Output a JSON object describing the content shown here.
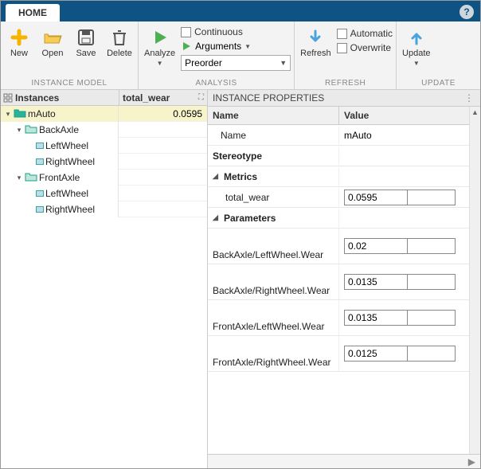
{
  "tabs": {
    "home": "HOME"
  },
  "ribbon": {
    "instance_model": {
      "label": "INSTANCE MODEL",
      "new": "New",
      "open": "Open",
      "save": "Save",
      "delete": "Delete"
    },
    "analysis": {
      "label": "ANALYSIS",
      "analyze": "Analyze",
      "continuous": "Continuous",
      "arguments": "Arguments",
      "combo_value": "Preorder"
    },
    "refresh": {
      "label": "REFRESH",
      "refresh": "Refresh",
      "automatic": "Automatic",
      "overwrite": "Overwrite"
    },
    "update": {
      "label": "UPDATE",
      "update": "Update"
    }
  },
  "left": {
    "col_instances": "Instances",
    "col_total_wear": "total_wear",
    "rows": [
      {
        "indent": 0,
        "expander": "▾",
        "icon": "folder-open",
        "label": "mAuto",
        "value": "0.0595",
        "selected": true
      },
      {
        "indent": 1,
        "expander": "▾",
        "icon": "folder",
        "label": "BackAxle",
        "value": ""
      },
      {
        "indent": 2,
        "expander": "",
        "icon": "leaf",
        "label": "LeftWheel",
        "value": ""
      },
      {
        "indent": 2,
        "expander": "",
        "icon": "leaf",
        "label": "RightWheel",
        "value": ""
      },
      {
        "indent": 1,
        "expander": "▾",
        "icon": "folder",
        "label": "FrontAxle",
        "value": ""
      },
      {
        "indent": 2,
        "expander": "",
        "icon": "leaf",
        "label": "LeftWheel",
        "value": ""
      },
      {
        "indent": 2,
        "expander": "",
        "icon": "leaf",
        "label": "RightWheel",
        "value": ""
      }
    ]
  },
  "right": {
    "title": "INSTANCE PROPERTIES",
    "col_name": "Name",
    "col_value": "Value",
    "rows": [
      {
        "kind": "plain",
        "name": "Name",
        "value_text": "mAuto"
      },
      {
        "kind": "section",
        "name": "Stereotype"
      },
      {
        "kind": "group",
        "name": "Metrics"
      },
      {
        "kind": "metric",
        "name": "total_wear",
        "value": "0.0595"
      },
      {
        "kind": "group",
        "name": "Parameters"
      },
      {
        "kind": "param",
        "name": "BackAxle/LeftWheel.Wear",
        "value": "0.02"
      },
      {
        "kind": "param",
        "name": "BackAxle/RightWheel.Wear",
        "value": "0.0135"
      },
      {
        "kind": "param",
        "name": "FrontAxle/LeftWheel.Wear",
        "value": "0.0135"
      },
      {
        "kind": "param",
        "name": "FrontAxle/RightWheel.Wear",
        "value": "0.0125"
      }
    ]
  }
}
